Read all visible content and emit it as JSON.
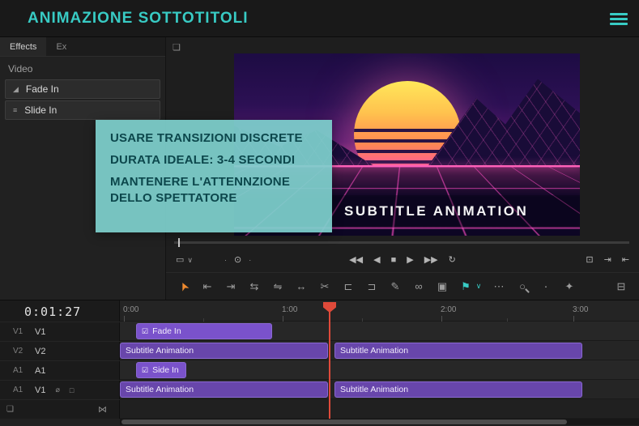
{
  "colors": {
    "accent_teal": "#38cbc4",
    "clip_purple": "#6846ab",
    "clip_purple_bright": "#7a52cb",
    "playhead_red": "#df4a3a",
    "tool_active_orange": "#ef8a2f",
    "overlay_teal": "#7ed0cc"
  },
  "header": {
    "title": "ANIMAZIONE SOTTOTITOLI"
  },
  "effects_panel": {
    "tabs": [
      {
        "label": "Effects"
      },
      {
        "label": "Ex"
      }
    ],
    "group_label": "Video",
    "items": [
      {
        "icon": "◢",
        "label": "Fade In"
      },
      {
        "icon": "≡",
        "label": "Slide In"
      }
    ]
  },
  "note_overlay": {
    "lines": [
      "USARE TRANSIZIONI DISCRETE",
      "DURATA IDEALE: 3-4 SECONDI",
      "MANTENERE L'ATTENNZIONE DELLO SPETTATORE"
    ]
  },
  "monitor": {
    "panel_icon": "❏",
    "caption": "SUBTITLE ANIMATION"
  },
  "transport": {
    "settings_icon": "▭",
    "settings_chevron": "∨",
    "markers": [
      "·",
      "⊙",
      "·"
    ],
    "buttons": [
      {
        "name": "go-to-start",
        "glyph": "◀◀"
      },
      {
        "name": "step-back",
        "glyph": "◀"
      },
      {
        "name": "stop",
        "glyph": "■"
      },
      {
        "name": "play",
        "glyph": "▶"
      },
      {
        "name": "go-to-end",
        "glyph": "▶▶"
      },
      {
        "name": "loop",
        "glyph": "↻"
      }
    ],
    "right_buttons": [
      {
        "name": "export-frame",
        "glyph": "⊡"
      },
      {
        "name": "next-edit",
        "glyph": "⇥"
      },
      {
        "name": "prev-edit",
        "glyph": "⇤"
      }
    ]
  },
  "toolbar": {
    "tools": [
      {
        "name": "selection",
        "glyph": "➤"
      },
      {
        "name": "track-select-backward",
        "glyph": "⇤"
      },
      {
        "name": "track-select-forward",
        "glyph": "⇥"
      },
      {
        "name": "ripple-edit",
        "glyph": "⇆"
      },
      {
        "name": "rolling-edit",
        "glyph": "⇋"
      },
      {
        "name": "rate-stretch",
        "glyph": "↔"
      },
      {
        "name": "razor",
        "glyph": "✂"
      },
      {
        "name": "slip",
        "glyph": "⊏"
      },
      {
        "name": "slide",
        "glyph": "⊐"
      },
      {
        "name": "pen",
        "glyph": "✎"
      },
      {
        "name": "link",
        "glyph": "∞"
      },
      {
        "name": "lock",
        "glyph": "▣"
      },
      {
        "name": "marker-flag",
        "glyph": "⚑"
      },
      {
        "name": "marker-flag-chevron",
        "glyph": "∨"
      },
      {
        "name": "more-options",
        "glyph": "⋯"
      },
      {
        "name": "zoom",
        "glyph": "○"
      },
      {
        "name": "snap-indicator",
        "glyph": "·"
      },
      {
        "name": "marker-shape",
        "glyph": "✦"
      },
      {
        "name": "panel-toggle",
        "glyph": "⊟"
      }
    ]
  },
  "timeline": {
    "timecode": "0:01:27",
    "ruler_labels": [
      "0:00",
      "1:00",
      "2:00",
      "3:00"
    ],
    "tracks": [
      {
        "num": "V1",
        "name": "V1"
      },
      {
        "num": "V2",
        "name": "V2"
      },
      {
        "num": "A1",
        "name": "A1"
      },
      {
        "num": "A1",
        "name": "V1",
        "icon1": "⌀",
        "icon2": "□"
      }
    ],
    "track_footer": {
      "left_icon": "❏",
      "right_icon": "⋈"
    },
    "clips": [
      {
        "label": "Fade In",
        "icon": "☑"
      },
      {
        "label": "Subtitle Animation"
      },
      {
        "label": "Subtitle Animation"
      },
      {
        "label": "Side In",
        "icon": "☑"
      },
      {
        "label": "Subtitle Animation"
      },
      {
        "label": "Subtitle Animation"
      }
    ]
  }
}
